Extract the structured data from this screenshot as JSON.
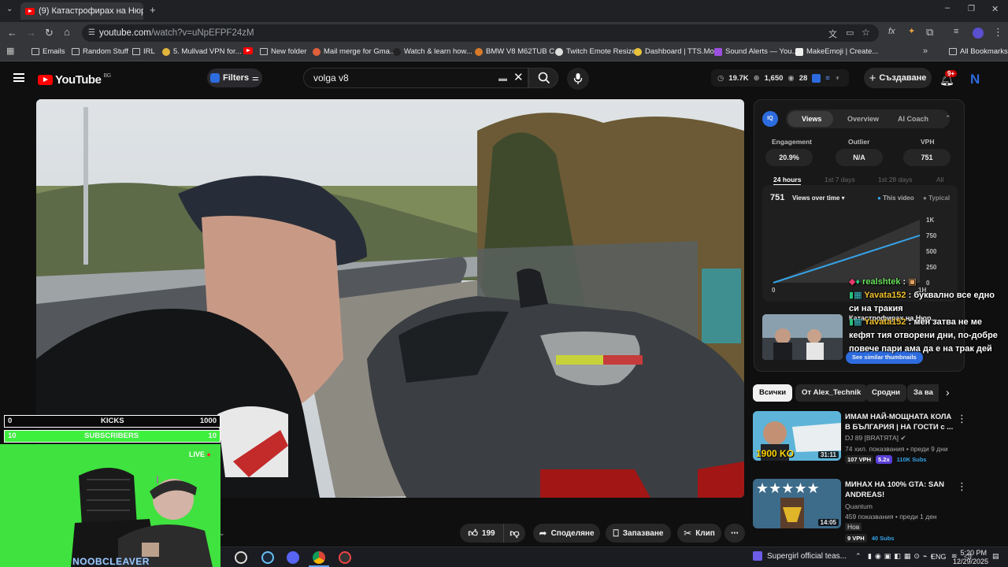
{
  "browser": {
    "tab_title": "(9) Катастрофирах на Нюр",
    "url_host": "youtube.com",
    "url_path": "/watch?v=uNpEFPF24zM",
    "bookmarks": [
      "Emails",
      "Random Stuff",
      "IRL",
      "5. Mullvad VPN for...",
      "",
      "New folder",
      "Mail merge for Gma...",
      "Watch & learn how...",
      "BMW V8 M62TUB C...",
      "Twitch Emote Resizer",
      "Dashboard | TTS.Mo...",
      "Sound Alerts — You...",
      "MakeEmoji | Create..."
    ],
    "all_bookmarks": "All Bookmarks"
  },
  "youtube": {
    "logo": "YouTube",
    "region": "BG",
    "filters_label": "Filters",
    "search_value": "volga v8",
    "stats": {
      "views": "19.7K",
      "likes": "1,650",
      "viewers": "28"
    },
    "create_label": "Създаване",
    "notif_count": "9+",
    "avatar_letter": "N"
  },
  "vidiq": {
    "tabs": [
      "Views",
      "Overview",
      "AI Coach"
    ],
    "metrics": [
      {
        "label": "Engagement",
        "value": "20.9%"
      },
      {
        "label": "Outlier",
        "value": "N/A"
      },
      {
        "label": "VPH",
        "value": "751"
      }
    ],
    "periods": [
      "24 hours",
      "1st 7 days",
      "1st 28 days",
      "All"
    ],
    "graph_value": "751",
    "graph_select": "Views over time",
    "legend_this": "This video",
    "legend_typical": "Typical",
    "thumb_title": "Катастрофирах на Нюр...",
    "thumb_button": "See similar thumbnails"
  },
  "chart_data": {
    "type": "line",
    "title": "",
    "xlabel": "",
    "ylabel": "",
    "x_ticks": [
      "0",
      "1H"
    ],
    "y_ticks": [
      "0",
      "250",
      "500",
      "750",
      "1K"
    ],
    "ylim": [
      0,
      1000
    ],
    "series": [
      {
        "name": "This video",
        "x": [
          0,
          1
        ],
        "values": [
          0,
          751
        ]
      },
      {
        "name": "Typical",
        "x": [
          0,
          1
        ],
        "values": [
          0,
          1000
        ]
      }
    ]
  },
  "chat": [
    {
      "user": "realshtek",
      "text": ""
    },
    {
      "user": "Yavata152",
      "text": "буквално все едно си на тракия"
    },
    {
      "user": "Yavata152",
      "text": "мен затва не ме кефят тия отворени дни, по-добре повече пари ама да е на трак дей"
    }
  ],
  "chips": [
    "Всички",
    "От Alex_Technik",
    "Сродни",
    "За ва"
  ],
  "recommendations": [
    {
      "title": "ИМАМ НАЙ-МОЩНАТА КОЛА В БЪЛГАРИЯ | НА ГОСТИ с ...",
      "channel": "DJ 89 [BRATЯТА]",
      "meta": "74 хил. показвания • преди 9 дни",
      "duration": "31:11",
      "thumb_text": "1900 KO",
      "vph": "107 VPH",
      "mult": "5.2x",
      "subs": "110K Subs"
    },
    {
      "title": "МИНАХ НА 100% GTA: SAN ANDREAS!",
      "channel": "Quantum",
      "meta": "459 показвания • преди 1 ден",
      "badge": "Нов",
      "duration": "14:05",
      "vph": "9 VPH",
      "subs": "40 Subs"
    }
  ],
  "actions": {
    "likes": "199",
    "share": "Споделяне",
    "save": "Запазване",
    "clip": "Клип"
  },
  "overlay": {
    "kicks_left": "0",
    "kicks_label": "KICKS",
    "kicks_right": "1000",
    "subs_left": "10",
    "subs_label": "SUBSCRIBERS",
    "subs_right": "10",
    "subs_progress": 1.0,
    "live": "LIVE",
    "streamer": "NOOBCLEAVER"
  },
  "taskbar": {
    "media_title": "Supergirl official teas...",
    "lang": "ENG",
    "time": "5:20 PM",
    "date": "12/29/2025"
  },
  "colors": {
    "accent_red": "#ff0000",
    "vidiq_blue": "#2d6cdf",
    "green_screen": "#3ee83e"
  }
}
